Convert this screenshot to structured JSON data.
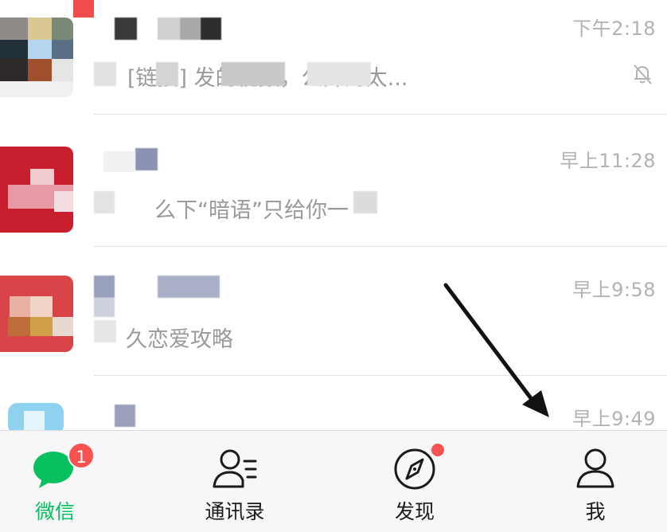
{
  "chats": [
    {
      "time": "下午2:18",
      "preview": "[链接] 发的视频，公开的太...",
      "muted": true
    },
    {
      "time": "早上11:28",
      "preview": "么下“暗语”只给你一",
      "muted": false
    },
    {
      "time": "早上9:58",
      "preview": "久恋爱攻略",
      "muted": false
    },
    {
      "time": "早上9:49",
      "preview": "",
      "muted": false
    }
  ],
  "tab_bar": {
    "tabs": [
      {
        "label": "微信",
        "icon": "chat-bubble-icon",
        "badge": "1",
        "active": true
      },
      {
        "label": "通讯录",
        "icon": "contacts-icon",
        "active": false
      },
      {
        "label": "发现",
        "icon": "compass-icon",
        "dot": true,
        "active": false
      },
      {
        "label": "我",
        "icon": "person-icon",
        "active": false
      }
    ]
  },
  "colors": {
    "accent": "#07c160",
    "badge": "#fa5151",
    "time_text": "#b2b2b2",
    "preview_text": "#9a9a9a"
  }
}
